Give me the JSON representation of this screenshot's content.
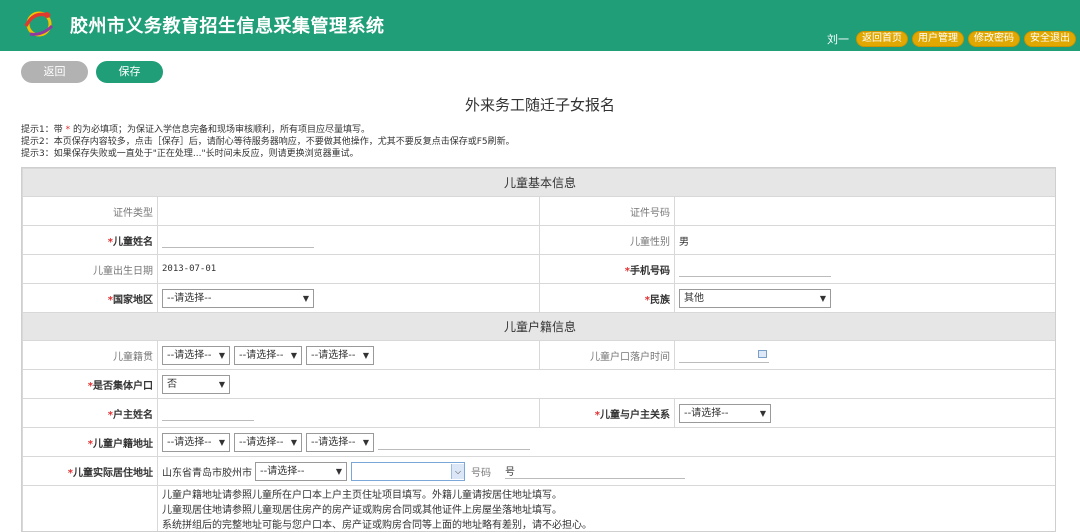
{
  "header": {
    "title": "胶州市义务教育招生信息采集管理系统",
    "user": "刘一",
    "buttons": [
      "返回首页",
      "用户管理",
      "修改密码",
      "安全退出"
    ]
  },
  "actions": {
    "back": "返回",
    "save": "保存"
  },
  "form_title": "外来务工随迁子女报名",
  "tips": {
    "t1_a": "提示1：带 ",
    "t1_star": "*",
    "t1_b": " 的为必填项；为保证入学信息完备和现场审核顺利，所有项目应尽量填写。",
    "t2": "提示2：本页保存内容较多，点击［保存］后，请耐心等待服务器响应，不要做其他操作，尤其不要反复点击保存或F5刷新。",
    "t3": "提示3：如果保存失败或一直处于\"正在处理...\"长时间未反应，则请更换浏览器重试。"
  },
  "sections": {
    "basic": "儿童基本信息",
    "household": "儿童户籍信息"
  },
  "req_mark": "*",
  "basic": {
    "id_type_label": "证件类型",
    "id_no_label": "证件号码",
    "name_label": "儿童姓名",
    "gender_label": "儿童性别",
    "gender_value": "男",
    "birth_label": "儿童出生日期",
    "birth_value": "2013-07-01",
    "phone_label": "手机号码",
    "country_label": "国家地区",
    "country_value": "--请选择--",
    "ethnic_label": "民族",
    "ethnic_value": "其他"
  },
  "household": {
    "native_label": "儿童籍贯",
    "settle_time_label": "儿童户口落户时间",
    "collective_label": "是否集体户口",
    "collective_value": "否",
    "owner_label": "户主姓名",
    "relation_label": "儿童与户主关系",
    "address_label": "儿童户籍地址",
    "actual_label": "儿童实际居住地址",
    "actual_prefix": "山东省青岛市胶州市",
    "num_label": "号码",
    "hao": "号",
    "please_select": "--请选择--",
    "notes": [
      "儿童户籍地址请参照儿童所在户口本上户主页住址项目填写。外籍儿童请按居住地址填写。",
      "儿童现居住地请参照儿童现居住房产的房产证或购房合同或其他证件上房屋坐落地址填写。",
      "系统拼组后的完整地址可能与您户口本、房产证或购房合同等上面的地址略有差别，请不必担心。"
    ]
  }
}
